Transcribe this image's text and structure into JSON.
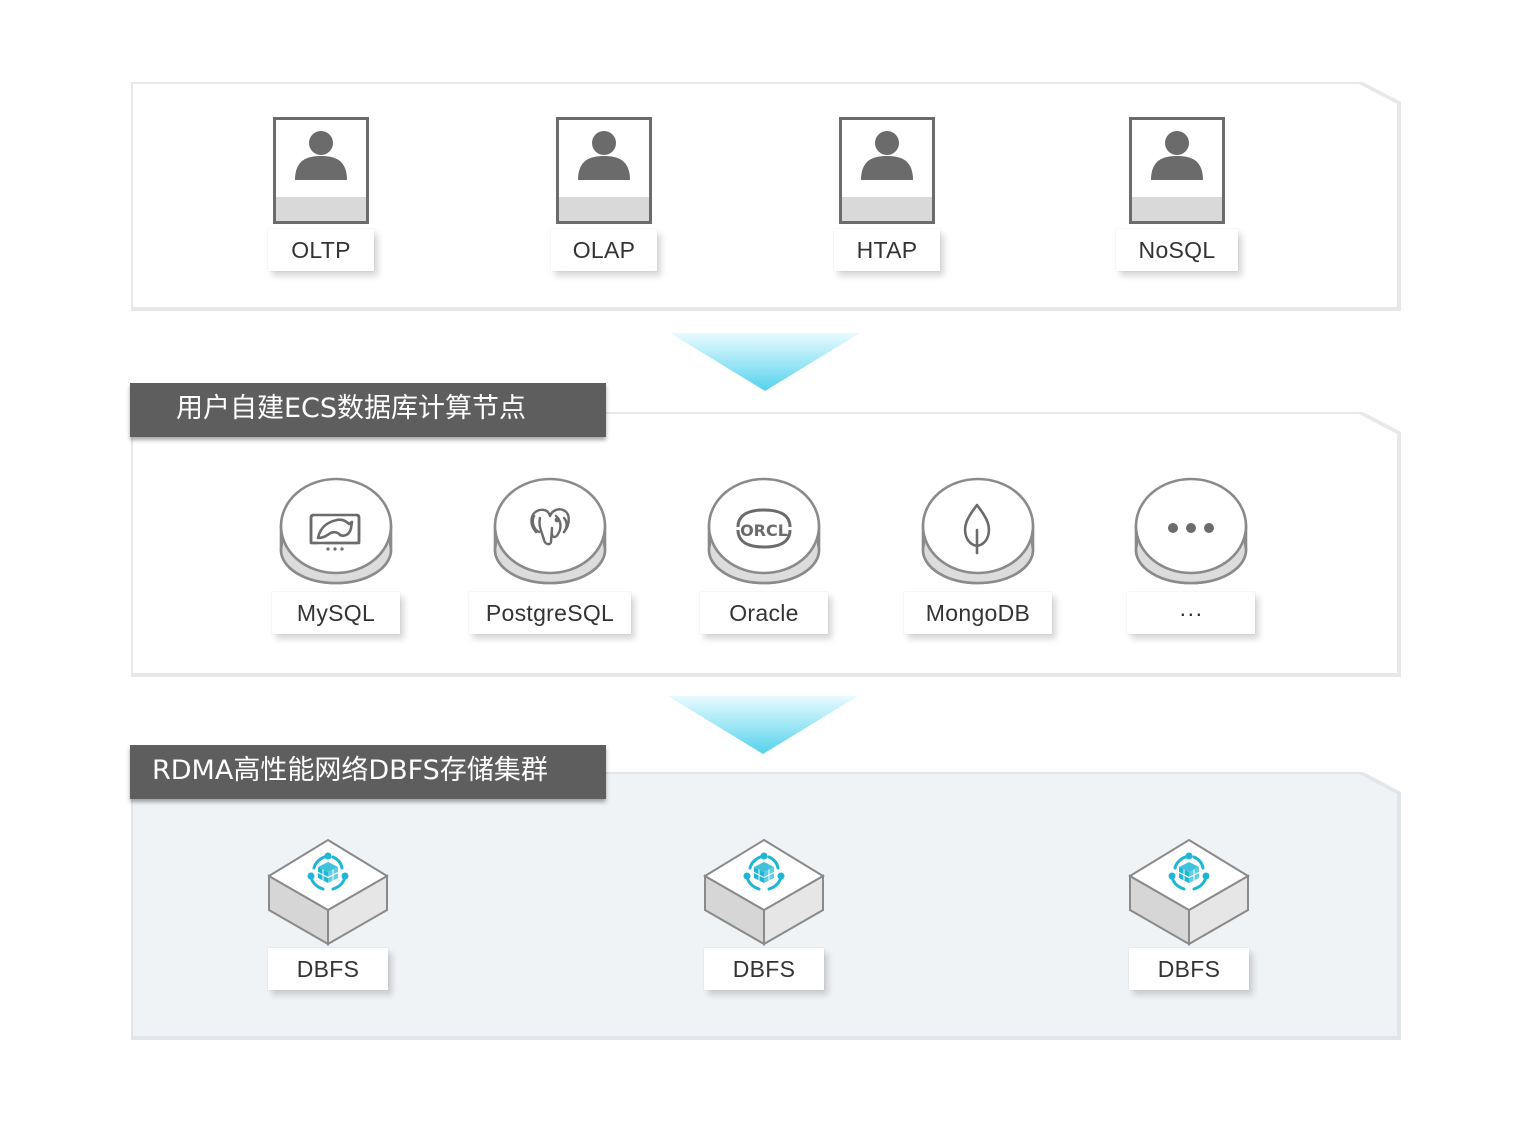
{
  "workloads": [
    {
      "label": "OLTP",
      "icon": "user-icon"
    },
    {
      "label": "OLAP",
      "icon": "user-icon"
    },
    {
      "label": "HTAP",
      "icon": "user-icon"
    },
    {
      "label": "NoSQL",
      "icon": "user-icon"
    }
  ],
  "compute_layer": {
    "title": "用户自建ECS数据库计算节点",
    "databases": [
      {
        "label": "MySQL",
        "icon": "mysql-dolphin-icon"
      },
      {
        "label": "PostgreSQL",
        "icon": "postgresql-elephant-icon"
      },
      {
        "label": "Oracle",
        "icon": "oracle-orcl-icon",
        "icon_text": "ORCL"
      },
      {
        "label": "MongoDB",
        "icon": "mongodb-leaf-icon"
      },
      {
        "label": "···",
        "icon": "more-dots-icon"
      }
    ]
  },
  "storage_layer": {
    "title": "RDMA高性能网络DBFS存储集群",
    "nodes": [
      {
        "label": "DBFS",
        "icon": "dbfs-cube-icon"
      },
      {
        "label": "DBFS",
        "icon": "dbfs-cube-icon"
      },
      {
        "label": "DBFS",
        "icon": "dbfs-cube-icon"
      }
    ]
  },
  "colors": {
    "arrow_top": "#e8fbff",
    "arrow_bottom": "#55d2ec",
    "title_bar": "#5e5e5e",
    "icon_gray": "#6b6b6b",
    "dbfs_accent": "#1fb6d6",
    "storage_panel": "#f0f3f6"
  }
}
